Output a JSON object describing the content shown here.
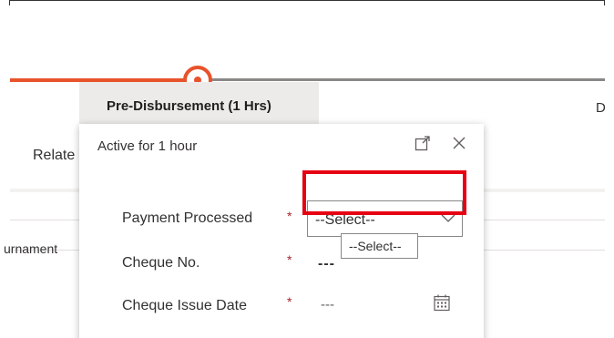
{
  "stage": {
    "active_label": "Pre-Disbursement  (1 Hrs)",
    "next_label": "D"
  },
  "background": {
    "related_label": "Relate",
    "tournament_label": "urnament"
  },
  "flyout": {
    "title": "Active for 1 hour",
    "fields": [
      {
        "label": "Payment Processed",
        "required": "*",
        "value": "--Select--"
      },
      {
        "label": "Cheque No.",
        "required": "*",
        "value": "---"
      },
      {
        "label": "Cheque Issue Date",
        "required": "*",
        "value": "---"
      }
    ],
    "dropdown_tooltip": "--Select--"
  },
  "colors": {
    "accent": "#e8532b",
    "highlight": "#e60012",
    "required": "#a4262c"
  },
  "icons": [
    "expand-icon",
    "close-icon",
    "chevron-down-icon",
    "calendar-icon"
  ]
}
